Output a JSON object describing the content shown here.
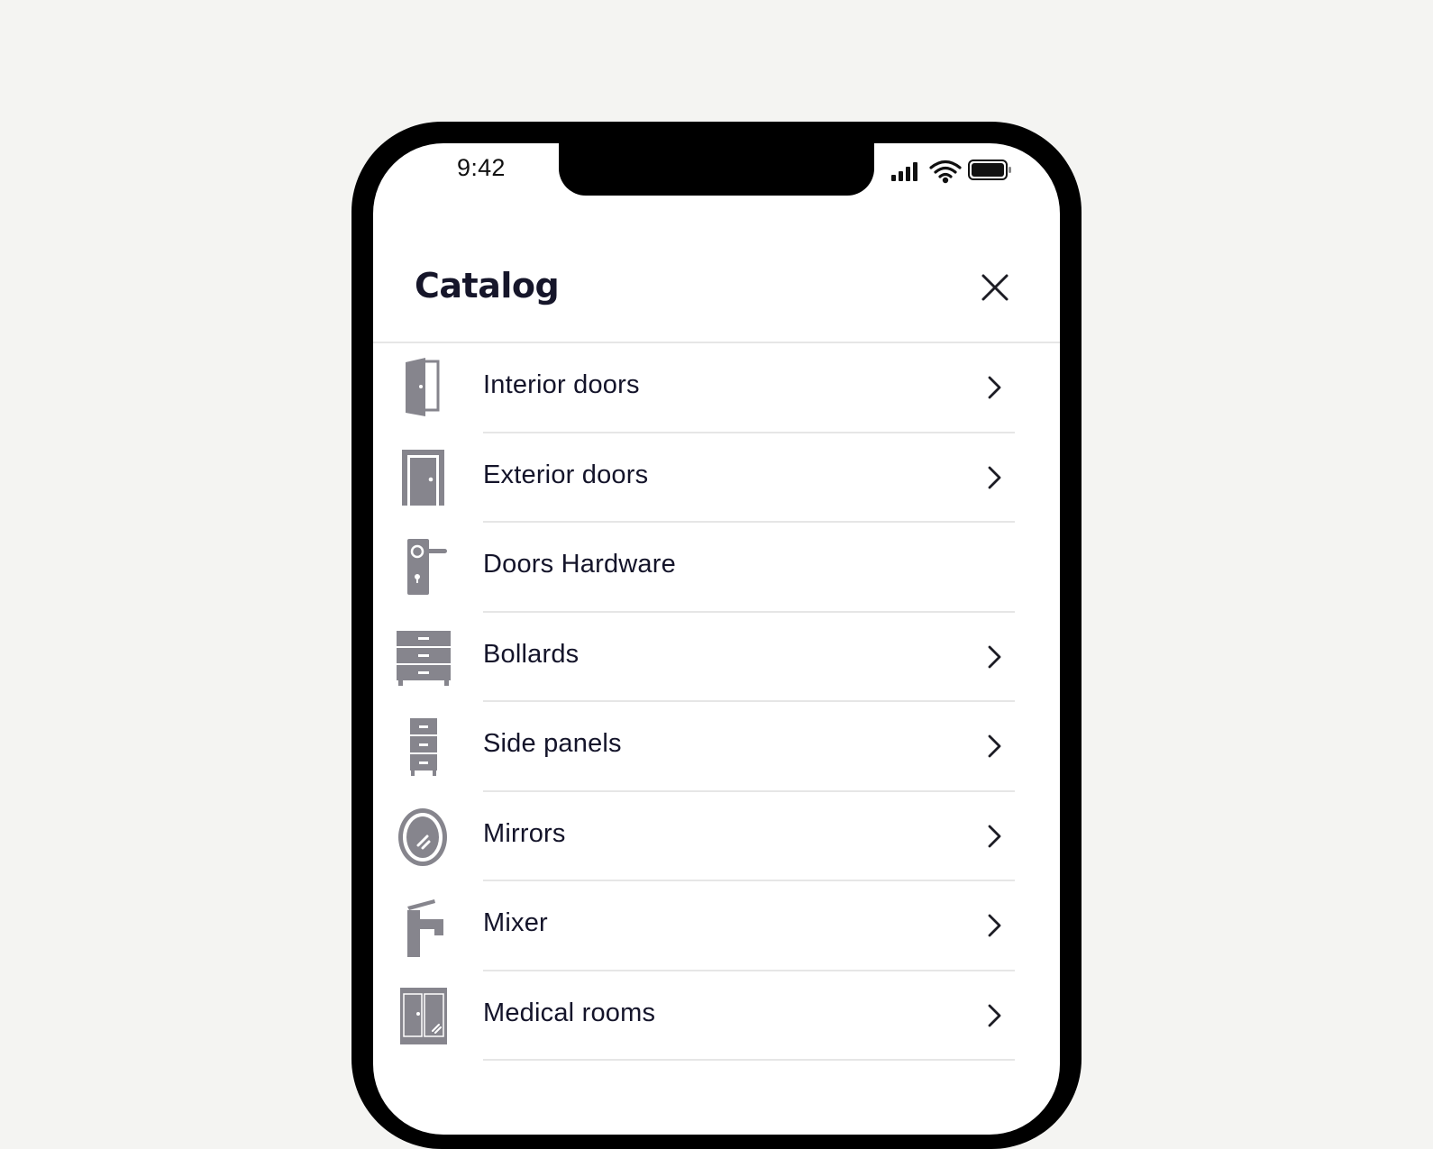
{
  "status_bar": {
    "time": "9:42"
  },
  "header": {
    "title": "Catalog",
    "close_icon": "close-icon"
  },
  "catalog_items": [
    {
      "label": "Interior doors",
      "icon": "interior-door-icon",
      "has_chevron": true
    },
    {
      "label": "Exterior doors",
      "icon": "exterior-door-icon",
      "has_chevron": true
    },
    {
      "label": "Doors Hardware",
      "icon": "door-handle-icon",
      "has_chevron": false
    },
    {
      "label": "Bollards",
      "icon": "dresser-icon",
      "has_chevron": true
    },
    {
      "label": "Side panels",
      "icon": "cabinet-icon",
      "has_chevron": true
    },
    {
      "label": "Mirrors",
      "icon": "mirror-icon",
      "has_chevron": true
    },
    {
      "label": "Mixer",
      "icon": "faucet-icon",
      "has_chevron": true
    },
    {
      "label": "Medical rooms",
      "icon": "wardrobe-icon",
      "has_chevron": true
    }
  ],
  "colors": {
    "background": "#f4f4f2",
    "icon_gray": "#86858d",
    "text": "#14142a",
    "divider": "#e6e6e6"
  }
}
